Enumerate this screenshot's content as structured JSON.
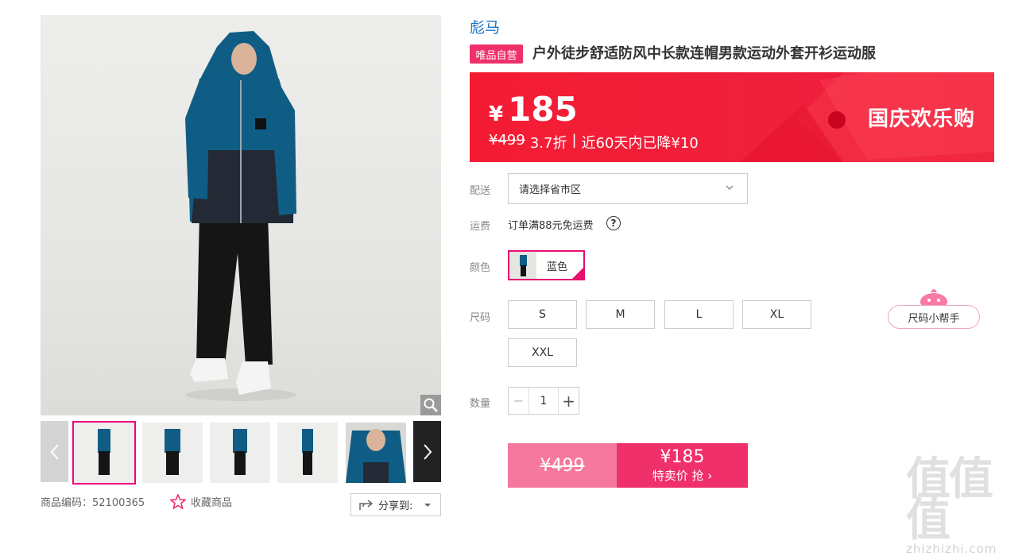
{
  "product": {
    "brand": "彪马",
    "self_tag": "唯品自营",
    "title": "户外徒步舒适防风中长款连帽男款运动外套开衫运动服"
  },
  "price": {
    "currency": "¥",
    "current": "185",
    "original": "¥499",
    "discount": "3.7折",
    "separator": "|",
    "drop_note": "近60天内已降¥10",
    "promo": "国庆欢乐购",
    "colors": {
      "banner": "#f41c33",
      "accent": "#f0306a"
    }
  },
  "delivery": {
    "label": "配送",
    "placeholder": "请选择省市区"
  },
  "shipping": {
    "label": "运费",
    "text": "订单满88元免运费",
    "help": "?"
  },
  "color": {
    "label": "颜色",
    "selected": "蓝色"
  },
  "size": {
    "label": "尺码",
    "options": [
      "S",
      "M",
      "L",
      "XL",
      "XXL"
    ],
    "helper": "尺码小帮手"
  },
  "quantity": {
    "label": "数量",
    "value": "1",
    "minus": "−",
    "plus": "+"
  },
  "buy": {
    "original_price": "¥499",
    "price": "¥185",
    "action": "特卖价 抢 ›"
  },
  "gallery": {
    "sku_label": "商品编码：52100365",
    "favorite": "收藏商品",
    "share": "分享到:"
  },
  "watermark": {
    "logo": "值值值",
    "domain": "zhizhizhi.com"
  }
}
